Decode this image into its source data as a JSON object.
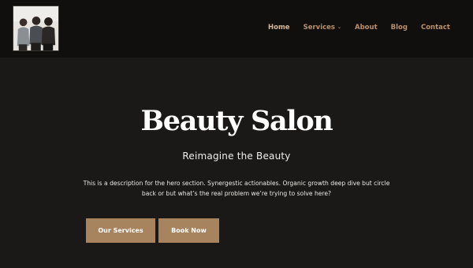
{
  "header": {
    "nav": [
      {
        "label": "Home"
      },
      {
        "label": "Services"
      },
      {
        "label": "About"
      },
      {
        "label": "Blog"
      },
      {
        "label": "Contact"
      }
    ]
  },
  "hero": {
    "title": "Beauty Salon",
    "subtitle": "Reimagine the Beauty",
    "description": "This is a description for the hero section. Synergestic actionables. Organic growth deep dive but circle back or but what’s the real problem we’re trying to solve here?",
    "buttons": {
      "primary_label": "Our Services",
      "secondary_label": "Book Now"
    }
  },
  "icons": {
    "services_dropdown": "chevron-down-icon"
  },
  "colors": {
    "header_bg": "#110f0e",
    "page_bg": "#1a1917",
    "nav_text": "#b9906a",
    "nav_active": "#d7b89b",
    "button_bg": "#a8845e"
  }
}
